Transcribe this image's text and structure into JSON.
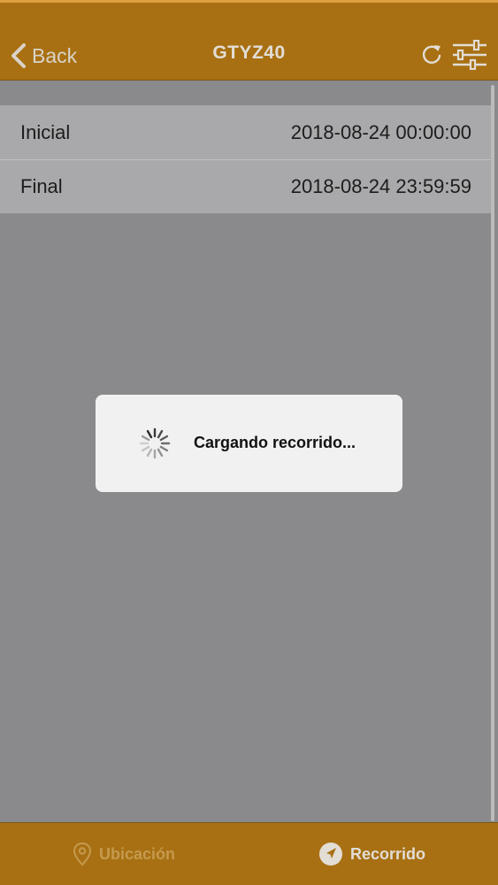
{
  "header": {
    "back_label": "Back",
    "title": "GTYZ40",
    "refresh_icon": "refresh-icon",
    "filter_icon": "sliders-icon"
  },
  "range": [
    {
      "label": "Inicial",
      "value": "2018-08-24 00:00:00"
    },
    {
      "label": "Final",
      "value": "2018-08-24 23:59:59"
    }
  ],
  "loading": {
    "text": "Cargando recorrido..."
  },
  "tabs": [
    {
      "label": "Ubicación",
      "icon": "location-pin-icon",
      "selected": false
    },
    {
      "label": "Recorrido",
      "icon": "navigation-arrow-icon",
      "selected": true
    }
  ],
  "colors": {
    "header_bg": "#a87012",
    "overlay": "#8a898b",
    "tab_active": "#e2ddd5",
    "tab_inactive": "#c59a4f"
  }
}
